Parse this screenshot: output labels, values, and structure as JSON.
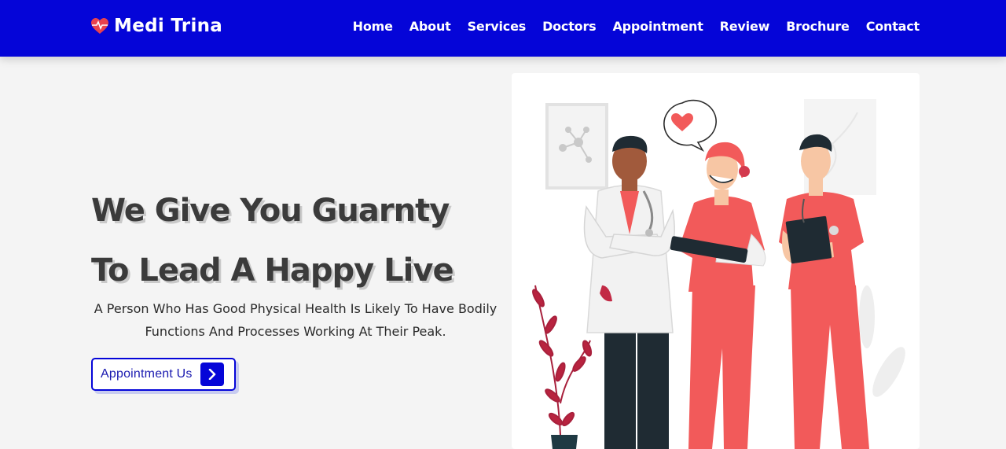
{
  "brand": {
    "name": "Medi Trina",
    "accent": "#0505d8",
    "heart_color": "#e8424e"
  },
  "nav": {
    "items": [
      "Home",
      "About",
      "Services",
      "Doctors",
      "Appointment",
      "Review",
      "Brochure",
      "Contact"
    ]
  },
  "hero": {
    "title_line1": "We Give You Guarnty",
    "title_line2": "To Lead A Happy Live",
    "subtitle": "A Person Who Has Good Physical Health Is Likely To Have Bodily Functions And Processes Working At Their Peak.",
    "cta_label": "Appointment Us",
    "cta_icon": "chevron-right-icon"
  },
  "illustration": {
    "subject": "medical-team-illustration",
    "colors": {
      "primary": "#f25a5a",
      "dark": "#1f2b33",
      "coat": "#f2f2f2"
    }
  }
}
